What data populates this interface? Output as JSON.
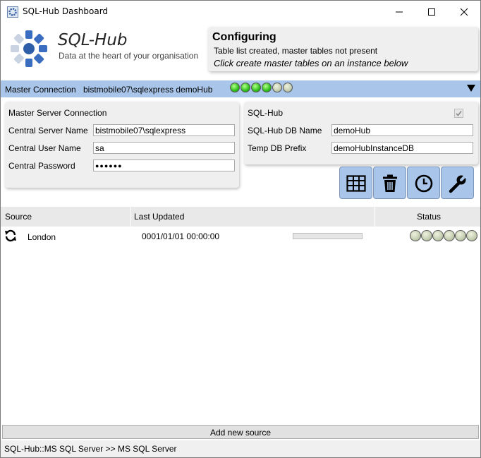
{
  "window": {
    "title": "SQL-Hub Dashboard",
    "controls": [
      "minimize-icon",
      "maximize-icon",
      "close-icon"
    ]
  },
  "header": {
    "brand_name": "SQL-Hub",
    "tagline": "Data at the heart of your organisation"
  },
  "status": {
    "title": "Configuring",
    "detail": "Table list created, master tables not present",
    "instruction": "Click create master tables on an instance below"
  },
  "master_connection": {
    "label": "Master Connection",
    "value": "bistmobile07\\sqlexpress demoHub",
    "leds": [
      true,
      true,
      true,
      true,
      false,
      false
    ],
    "expand_icon": "triangle-down-icon"
  },
  "server_panel": {
    "title": "Master Server Connection",
    "fields": [
      {
        "label": "Central Server Name",
        "value": "bistmobile07\\sqlexpress"
      },
      {
        "label": "Central User Name",
        "value": "sa"
      },
      {
        "label": "Central Password",
        "value": "●●●●●●"
      }
    ]
  },
  "hub_panel": {
    "title": "SQL-Hub",
    "checked": true,
    "fields": [
      {
        "label": "SQL-Hub DB Name",
        "value": "demoHub"
      },
      {
        "label": "Temp DB Prefix",
        "value": "demoHubInstanceDB"
      }
    ]
  },
  "toolbar": {
    "buttons": [
      "table-grid-icon",
      "trash-icon",
      "clock-icon",
      "wrench-icon"
    ]
  },
  "grid": {
    "columns": [
      "Source",
      "Last Updated",
      "Status"
    ],
    "rows": [
      {
        "icon": "refresh-icon",
        "source": "London",
        "last_updated": "0001/01/01 00:00:00",
        "progress": 0,
        "leds": [
          false,
          false,
          false,
          false,
          false,
          false
        ]
      }
    ]
  },
  "add_source_label": "Add new source",
  "statusbar": {
    "text": "SQL-Hub::MS SQL Server >> MS SQL Server"
  },
  "colors": {
    "accent_blue": "#a9c6ea",
    "led_on": "#2ec01a",
    "led_off": "#c4cdb0",
    "panel_bg": "#efefef"
  }
}
